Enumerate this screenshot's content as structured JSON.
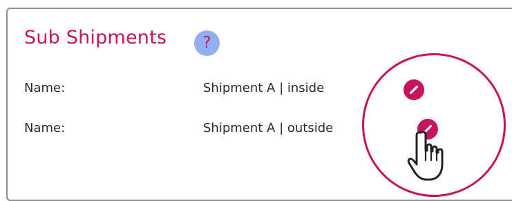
{
  "section": {
    "title": "Sub Shipments",
    "help_glyph": "?",
    "help_icon": "help-icon"
  },
  "rows": [
    {
      "label": "Name:",
      "value": "Shipment A | inside",
      "action_icon": "pencil-icon"
    },
    {
      "label": "Name:",
      "value": "Shipment A | outside",
      "action_icon": "pencil-icon"
    }
  ],
  "cursor": "hand-pointer-icon",
  "colors": {
    "accent": "#c8135d",
    "help_bg": "#93aef2",
    "text": "#2b2b2b",
    "border": "#8e8e8e"
  }
}
